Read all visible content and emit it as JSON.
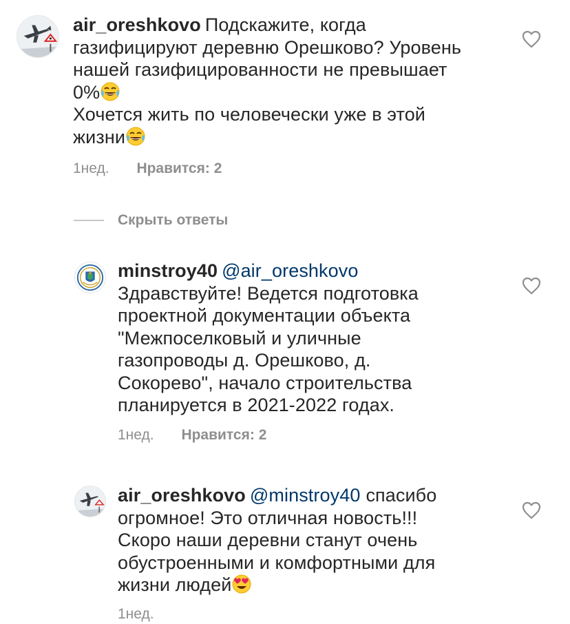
{
  "comments": [
    {
      "username": "air_oreshkovo",
      "lines": [
        "Подскажите, когда",
        "газифицируют деревню Орешково? Уровень",
        "нашей газифицированности не превышает",
        "0%",
        "Хочется жить по человечески уже в этой",
        "жизни"
      ],
      "time": "1нед.",
      "likes": "Нравится: 2"
    },
    {
      "username": "minstroy40",
      "mention": "@air_oreshkovo",
      "lines": [
        "Здравствуйте! Ведется подготовка",
        "проектной документации объекта",
        "\"Межпоселковый и уличные",
        "газопроводы д. Орешково, д.",
        "Сокорево\", начало строительства",
        "планируется в 2021-2022 годах."
      ],
      "time": "1нед.",
      "likes": "Нравится: 2"
    },
    {
      "username": "air_oreshkovo",
      "mention": "@minstroy40",
      "lines": [
        "спасибо",
        "огромное! Это отличная новость!!!",
        "Скоро наши деревни станут очень",
        "обустроенными и комфортными для",
        "жизни людей"
      ],
      "time": "1нед."
    }
  ],
  "replies_toggle": "Скрыть ответы",
  "icons": {
    "like": "heart-outline-icon",
    "emoji_laugh": "face-with-tears-of-joy-emoji",
    "emoji_love": "heart-eyes-emoji"
  },
  "colors": {
    "text": "#262626",
    "secondary": "#8e8e8e",
    "mention": "#00376b"
  }
}
